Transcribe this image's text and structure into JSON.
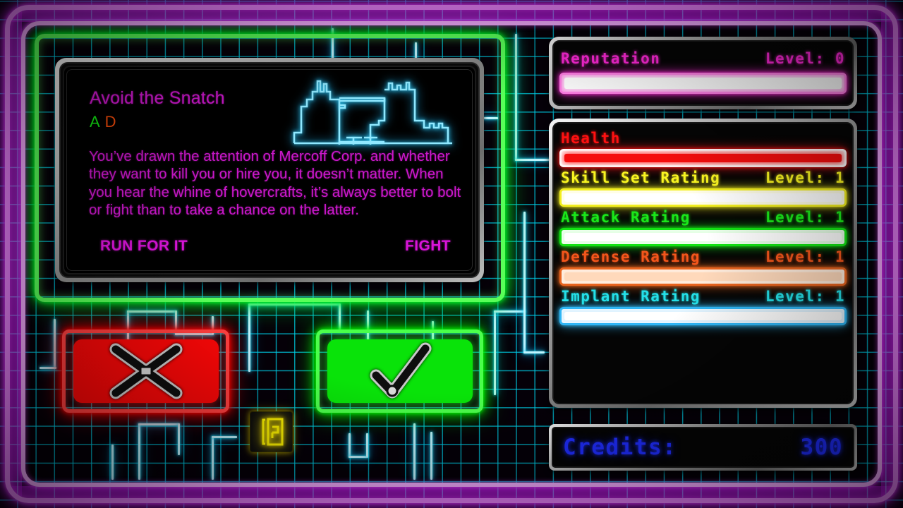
{
  "card": {
    "title": "Avoid the Snatch",
    "code_a": "A",
    "code_d": "D",
    "body": "You’ve drawn the attention of Mercoff Corp. and whether they want to kill you or hire you, it doesn’t matter. When you hear the whine of hovercrafts, it’s always better to bolt or fight than to take a chance on the latter.",
    "action_left": "RUN FOR IT",
    "action_right": "FIGHT",
    "art_icon": "city-skyline-icon"
  },
  "choices": {
    "decline_icon": "x-mark-icon",
    "accept_icon": "check-mark-icon",
    "door_icon": "door-exit-icon"
  },
  "reputation": {
    "label": "Reputation",
    "level_label": "Level: 0",
    "bar_fill_percent": 0,
    "color": "#ff28d8"
  },
  "stats": [
    {
      "name": "Health",
      "level_label": "",
      "bar_fill_percent": 100,
      "color": "#ff1111"
    },
    {
      "name": "Skill Set Rating",
      "level_label": "Level: 1",
      "bar_fill_percent": 0,
      "color": "#f9f521"
    },
    {
      "name": "Attack Rating",
      "level_label": "Level: 1",
      "bar_fill_percent": 0,
      "color": "#1ae81a"
    },
    {
      "name": "Defense Rating",
      "level_label": "Level: 1",
      "bar_fill_percent": 0,
      "color": "#f4561b"
    },
    {
      "name": "Implant Rating",
      "level_label": "Level: 1",
      "bar_fill_percent": 0,
      "color": "#24e0e8"
    }
  ],
  "credits": {
    "label": "Credits:",
    "value": "300",
    "color": "#1f2dff"
  },
  "theme": {
    "frame_color": "#e585f5",
    "card_frame_color": "#58ff58",
    "grid_color": "#00d2eb",
    "decline_color": "#f90707",
    "accept_color": "#09e309"
  }
}
